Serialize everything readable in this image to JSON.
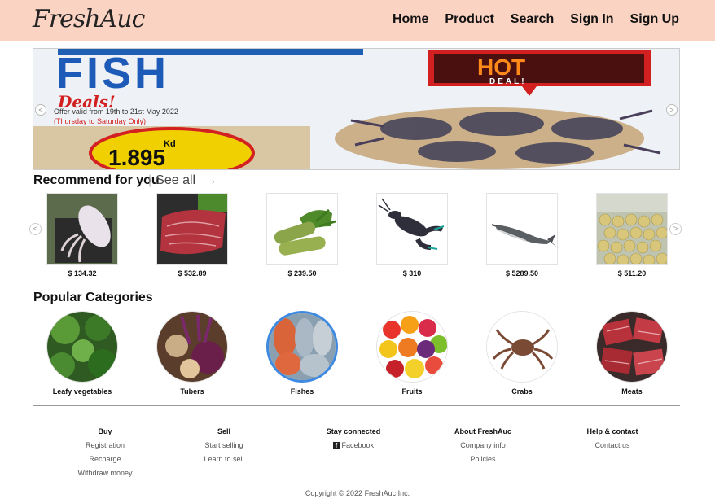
{
  "nav": {
    "logo": "FreshAuc",
    "links": [
      "Home",
      "Product",
      "Search",
      "Sign In",
      "Sign Up"
    ]
  },
  "banner": {
    "headline": "FISH",
    "subheadline": "Deals!",
    "offer": "Offer valid from 19th to 21st May 2022",
    "days": "(Thursday to Saturday Only)",
    "hot": "HOT",
    "deal": "DEAL!",
    "price_unit": "Kd",
    "price": "1.895"
  },
  "recommend": {
    "title": "Recommend for you",
    "see_all": "See all",
    "products": [
      {
        "price": "$ 134.32",
        "icon": "squid-icon"
      },
      {
        "price": "$ 532.89",
        "icon": "steak-icon"
      },
      {
        "price": "$ 239.50",
        "icon": "wasabi-icon"
      },
      {
        "price": "$ 310",
        "icon": "lobster-icon"
      },
      {
        "price": "$ 5289.50",
        "icon": "sturgeon-icon"
      },
      {
        "price": "$ 511.20",
        "icon": "potatoes-icon"
      }
    ]
  },
  "categories": {
    "title": "Popular Categories",
    "items": [
      "Leafy vegetables",
      "Tubers",
      "Fishes",
      "Fruits",
      "Crabs",
      "Meats"
    ]
  },
  "footer": {
    "columns": [
      {
        "heading": "Buy",
        "links": [
          "Registration",
          "Recharge",
          "Withdraw money"
        ]
      },
      {
        "heading": "Sell",
        "links": [
          "Start selling",
          "Learn to sell"
        ]
      },
      {
        "heading": "Stay connected",
        "links": [
          "Facebook"
        ]
      },
      {
        "heading": "About FreshAuc",
        "links": [
          "Company info",
          "Policies"
        ]
      },
      {
        "heading": "Help & contact",
        "links": [
          "Contact us"
        ]
      }
    ],
    "copyright": "Copyright © 2022 FreshAuc Inc."
  },
  "colors": {
    "nav_bg": "#fbd3c3",
    "selected_ring": "#3e8ae0"
  }
}
